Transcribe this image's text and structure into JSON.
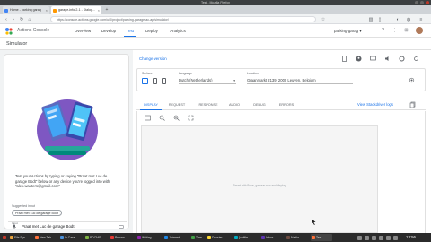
{
  "window": {
    "title": "Test - Mozilla Firefox"
  },
  "browser": {
    "tabs": [
      {
        "label": "Home - parking garag",
        "active": false
      },
      {
        "label": "garage-info-2-1 - Dialog...",
        "active": true
      }
    ],
    "url": "https://console.actions.google.com/u/0/project/parking-garage-ac-ap/simulator/"
  },
  "app": {
    "name": "Actions Console",
    "nav": [
      "Overview",
      "Develop",
      "Test",
      "Deploy",
      "Analytics"
    ],
    "active_nav": "Test",
    "project": "parking-garag"
  },
  "simulator": {
    "title": "Simulator",
    "intro_text": "Test your Actions by typing or saying \"Praat met Luc de garage Bodt\" below or any device you're logged into with \"alex.wauters@gmail.com\"",
    "suggested_label": "Suggested input",
    "suggestion": "Praat met Luc de garage Bodt",
    "input_label": "Input",
    "input_value": "Praat met Luc de garage Bodt"
  },
  "settings": {
    "change_version": "Change version",
    "surface_label": "Surface",
    "language_label": "Language",
    "language_value": "Dutch (Netherlands)",
    "location_label": "Location",
    "location_value": "Graanmarkt 2139, 2000 Leuven, Belgium"
  },
  "result_tabs": [
    "DISPLAY",
    "REQUEST",
    "RESPONSE",
    "AUDIO",
    "DEBUG",
    "ERRORS"
  ],
  "active_result_tab": "DISPLAY",
  "view_link": "View Stackdriver logs",
  "display_message": "Smart with Bose, ga naar een and display",
  "taskbar": {
    "items": [
      "File Sys",
      "New Tab",
      "In Case...",
      "PDCMS",
      "Presen...",
      "Writing...",
      "Jobseek...",
      "Tree",
      "Dossier...",
      "[untitle...",
      "Inbox -...",
      "Nadia...",
      "Test..."
    ],
    "clock": "13:56"
  },
  "colors": {
    "accent": "#1a73e8",
    "taskbar": "#2b2b2b"
  }
}
